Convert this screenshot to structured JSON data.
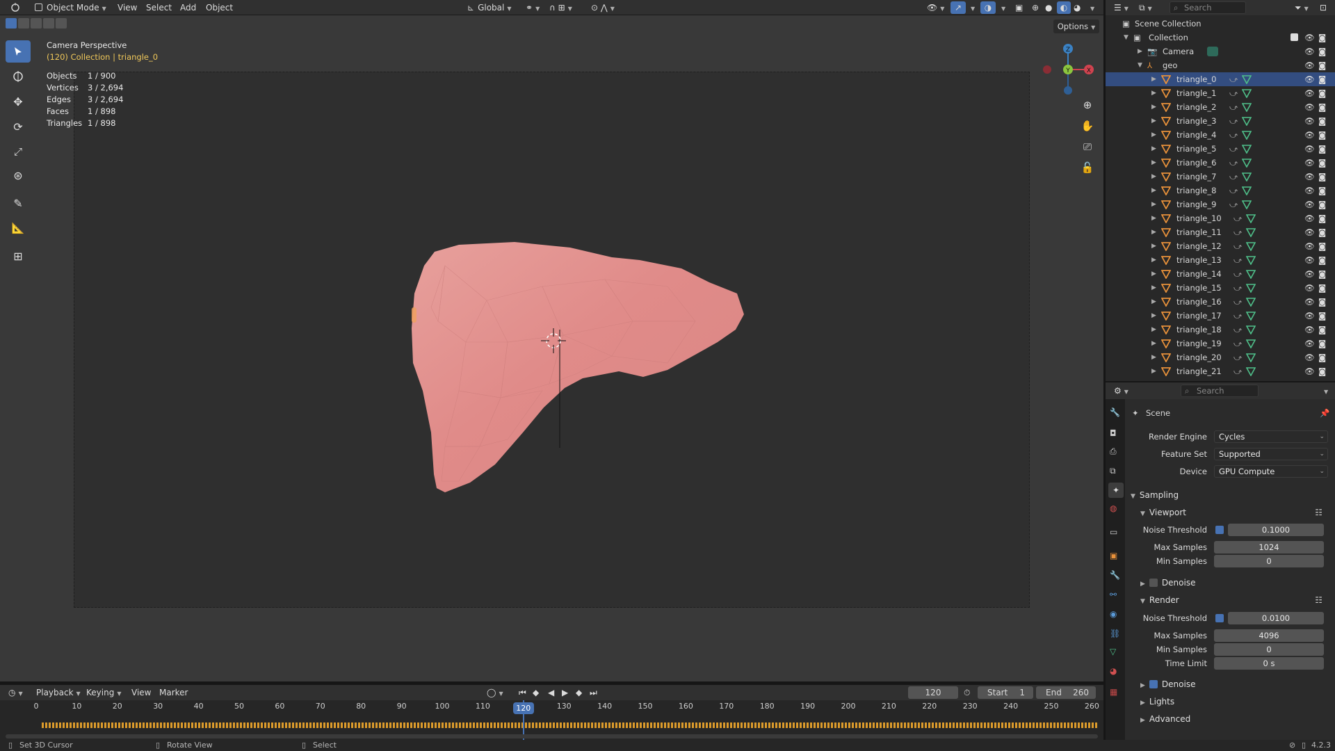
{
  "header": {
    "mode": "Object Mode",
    "menus": [
      "View",
      "Select",
      "Add",
      "Object"
    ],
    "orientation": "Global",
    "options_label": "Options"
  },
  "viewport": {
    "view_name": "Camera Perspective",
    "collection_line": "(120) Collection | triangle_0",
    "stats": [
      {
        "label": "Objects",
        "value": "1 / 900"
      },
      {
        "label": "Vertices",
        "value": "3 / 2,694"
      },
      {
        "label": "Edges",
        "value": "3 / 2,694"
      },
      {
        "label": "Faces",
        "value": "1 / 898"
      },
      {
        "label": "Triangles",
        "value": "1 / 898"
      }
    ],
    "gizmo": {
      "x": "X",
      "y": "Y",
      "z": "Z"
    },
    "model_color": "#e89a95"
  },
  "outliner": {
    "search_placeholder": "Search",
    "scene_collection": "Scene Collection",
    "collection": "Collection",
    "camera": "Camera",
    "geo": "geo",
    "objects": [
      "triangle_0",
      "triangle_1",
      "triangle_2",
      "triangle_3",
      "triangle_4",
      "triangle_5",
      "triangle_6",
      "triangle_7",
      "triangle_8",
      "triangle_9",
      "triangle_10",
      "triangle_11",
      "triangle_12",
      "triangle_13",
      "triangle_14",
      "triangle_15",
      "triangle_16",
      "triangle_17",
      "triangle_18",
      "triangle_19",
      "triangle_20",
      "triangle_21"
    ],
    "selected_index": 0
  },
  "properties": {
    "search_placeholder": "Search",
    "context": "Scene",
    "render_engine_label": "Render Engine",
    "render_engine": "Cycles",
    "feature_set_label": "Feature Set",
    "feature_set": "Supported",
    "device_label": "Device",
    "device": "GPU Compute",
    "sampling": "Sampling",
    "viewport": "Viewport",
    "noise_threshold_label": "Noise Threshold",
    "viewport_noise_threshold": "0.1000",
    "max_samples_label": "Max Samples",
    "viewport_max_samples": "1024",
    "min_samples_label": "Min Samples",
    "viewport_min_samples": "0",
    "denoise": "Denoise",
    "render": "Render",
    "render_noise_threshold": "0.0100",
    "render_max_samples": "4096",
    "render_min_samples": "0",
    "time_limit_label": "Time Limit",
    "time_limit": "0 s",
    "lights": "Lights",
    "advanced": "Advanced"
  },
  "timeline": {
    "menus": [
      "Playback",
      "Keying",
      "View",
      "Marker"
    ],
    "current_frame": "120",
    "start_label": "Start",
    "start": "1",
    "end_label": "End",
    "end": "260",
    "ticks": [
      "0",
      "10",
      "20",
      "30",
      "40",
      "50",
      "60",
      "70",
      "80",
      "90",
      "100",
      "110",
      "120",
      "130",
      "140",
      "150",
      "160",
      "170",
      "180",
      "190",
      "200",
      "210",
      "220",
      "230",
      "240",
      "250",
      "260"
    ]
  },
  "statusbar": {
    "left": "Set 3D Cursor",
    "middle": "Rotate View",
    "right": "Select",
    "version": "4.2.3"
  }
}
